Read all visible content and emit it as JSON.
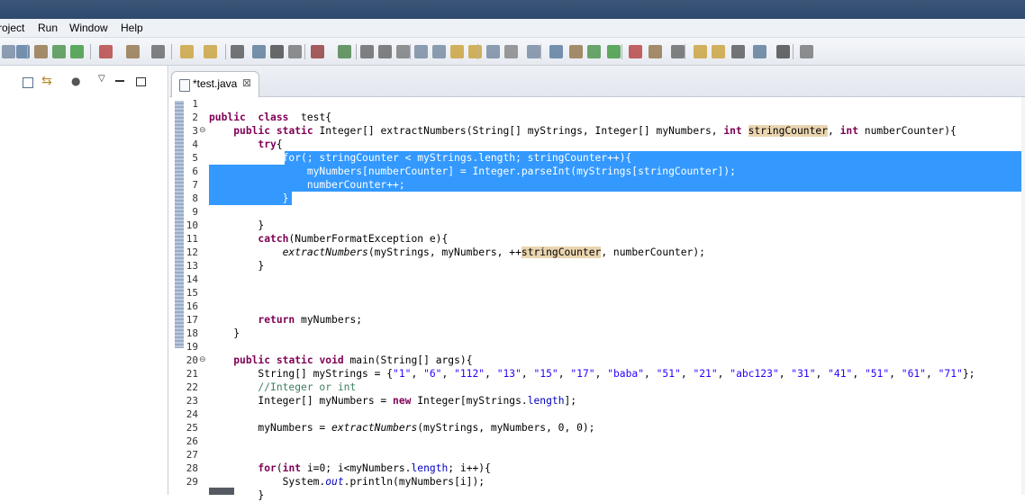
{
  "menu": {
    "items": [
      "roject",
      "Run",
      "Window",
      "Help"
    ]
  },
  "toolbar": {
    "icon_colors": [
      "#6b7f99",
      "#4b6f96",
      "#8a6a3a",
      "#3c8a3c",
      "#2d8f2d",
      "#b03030",
      "#8a6a3a",
      "#5a5a5a",
      "#c79a2a",
      "#c79a2a",
      "#4a4a4a",
      "#4f6f8f",
      "#3a3a3a",
      "#6b6b6b",
      "#8a2a2a",
      "#3a7a3a",
      "#5a5a5a",
      "#5a5a5a",
      "#6f6f6f",
      "#6a7f99",
      "#6a7f99",
      "#c79a2a",
      "#c79a2a",
      "#6a7f99",
      "#7a7a7a"
    ]
  },
  "left_panel": {
    "icons": [
      "collapse-all-icon",
      "link-with-editor-icon",
      "focus-icon",
      "view-menu-icon",
      "minimize-icon",
      "maximize-icon"
    ]
  },
  "editor": {
    "tab": {
      "label": "*test.java",
      "close": "⊠"
    },
    "lines": [
      {
        "n": "1",
        "fold": "",
        "segs": []
      },
      {
        "n": "2",
        "fold": "",
        "segs": [
          [
            "kw",
            "public"
          ],
          [
            "",
            "  "
          ],
          [
            "kw",
            "class"
          ],
          [
            "",
            "  test{"
          ]
        ]
      },
      {
        "n": "3",
        "fold": "⊖",
        "segs": [
          [
            "",
            "    "
          ],
          [
            "kw",
            "public"
          ],
          [
            "",
            " "
          ],
          [
            "kw",
            "static"
          ],
          [
            "",
            " Integer[] extractNumbers(String[] myStrings, Integer[] myNumbers, "
          ],
          [
            "kw",
            "int"
          ],
          [
            "",
            " "
          ],
          [
            "occ",
            "stringCounter"
          ],
          [
            "",
            ", "
          ],
          [
            "kw",
            "int"
          ],
          [
            "",
            " numberCounter){"
          ]
        ]
      },
      {
        "n": "4",
        "fold": "",
        "segs": [
          [
            "",
            "        "
          ],
          [
            "kw",
            "try"
          ],
          [
            "",
            "{"
          ]
        ]
      },
      {
        "n": "5",
        "fold": "",
        "segs": [
          [
            "",
            "            "
          ],
          [
            "sel",
            "for(; stringCounter < myStrings.length; stringCounter++){"
          ]
        ]
      },
      {
        "n": "6",
        "fold": "",
        "segs": [
          [
            "sel",
            "                myNumbers[numberCounter] = Integer.parseInt(myStrings[stringCounter]);"
          ]
        ]
      },
      {
        "n": "7",
        "fold": "",
        "segs": [
          [
            "sel",
            "                numberCounter++;"
          ]
        ]
      },
      {
        "n": "8",
        "fold": "",
        "segs": [
          [
            "sel",
            "            }"
          ]
        ]
      },
      {
        "n": "9",
        "fold": "",
        "segs": []
      },
      {
        "n": "10",
        "fold": "",
        "segs": [
          [
            "",
            "        }"
          ]
        ]
      },
      {
        "n": "11",
        "fold": "",
        "segs": [
          [
            "",
            "        "
          ],
          [
            "kw",
            "catch"
          ],
          [
            "",
            "(NumberFormatException e){"
          ]
        ]
      },
      {
        "n": "12",
        "fold": "",
        "segs": [
          [
            "",
            "            "
          ],
          [
            "it",
            "extractNumbers"
          ],
          [
            "",
            "(myStrings, myNumbers, ++"
          ],
          [
            "occ",
            "stringCounter"
          ],
          [
            "",
            ", numberCounter);"
          ]
        ]
      },
      {
        "n": "13",
        "fold": "",
        "segs": [
          [
            "",
            "        }"
          ]
        ]
      },
      {
        "n": "14",
        "fold": "",
        "segs": []
      },
      {
        "n": "15",
        "fold": "",
        "segs": []
      },
      {
        "n": "16",
        "fold": "",
        "segs": []
      },
      {
        "n": "17",
        "fold": "",
        "segs": [
          [
            "",
            "        "
          ],
          [
            "kw",
            "return"
          ],
          [
            "",
            " myNumbers;"
          ]
        ]
      },
      {
        "n": "18",
        "fold": "",
        "segs": [
          [
            "",
            "    }"
          ]
        ]
      },
      {
        "n": "19",
        "fold": "",
        "segs": []
      },
      {
        "n": "20",
        "fold": "⊖",
        "segs": [
          [
            "",
            "    "
          ],
          [
            "kw",
            "public"
          ],
          [
            "",
            " "
          ],
          [
            "kw",
            "static"
          ],
          [
            "",
            " "
          ],
          [
            "kw",
            "void"
          ],
          [
            "",
            " main(String[] args){"
          ]
        ]
      },
      {
        "n": "21",
        "fold": "",
        "segs": [
          [
            "",
            "        String[] myStrings = {"
          ],
          [
            "str",
            "\"1\""
          ],
          [
            "",
            ", "
          ],
          [
            "str",
            "\"6\""
          ],
          [
            "",
            ", "
          ],
          [
            "str",
            "\"112\""
          ],
          [
            "",
            ", "
          ],
          [
            "str",
            "\"13\""
          ],
          [
            "",
            ", "
          ],
          [
            "str",
            "\"15\""
          ],
          [
            "",
            ", "
          ],
          [
            "str",
            "\"17\""
          ],
          [
            "",
            ", "
          ],
          [
            "str",
            "\"baba\""
          ],
          [
            "",
            ", "
          ],
          [
            "str",
            "\"51\""
          ],
          [
            "",
            ", "
          ],
          [
            "str",
            "\"21\""
          ],
          [
            "",
            ", "
          ],
          [
            "str",
            "\"abc123\""
          ],
          [
            "",
            ", "
          ],
          [
            "str",
            "\"31\""
          ],
          [
            "",
            ", "
          ],
          [
            "str",
            "\"41\""
          ],
          [
            "",
            ", "
          ],
          [
            "str",
            "\"51\""
          ],
          [
            "",
            ", "
          ],
          [
            "str",
            "\"61\""
          ],
          [
            "",
            ", "
          ],
          [
            "str",
            "\"71\""
          ],
          [
            "",
            "};"
          ]
        ]
      },
      {
        "n": "22",
        "fold": "",
        "segs": [
          [
            "",
            "        "
          ],
          [
            "cmt",
            "//Integer or int"
          ]
        ]
      },
      {
        "n": "23",
        "fold": "",
        "segs": [
          [
            "",
            "        Integer[] myNumbers = "
          ],
          [
            "kw",
            "new"
          ],
          [
            "",
            " Integer[myStrings."
          ],
          [
            "fld",
            "length"
          ],
          [
            "",
            "];"
          ]
        ]
      },
      {
        "n": "24",
        "fold": "",
        "segs": []
      },
      {
        "n": "25",
        "fold": "",
        "segs": [
          [
            "",
            "        myNumbers = "
          ],
          [
            "it",
            "extractNumbers"
          ],
          [
            "",
            "(myStrings, myNumbers, 0, 0);"
          ]
        ]
      },
      {
        "n": "26",
        "fold": "",
        "segs": []
      },
      {
        "n": "27",
        "fold": "",
        "segs": []
      },
      {
        "n": "28",
        "fold": "",
        "segs": [
          [
            "",
            "        "
          ],
          [
            "kw",
            "for"
          ],
          [
            "",
            "("
          ],
          [
            "kw",
            "int"
          ],
          [
            "",
            " i=0; i<myNumbers."
          ],
          [
            "fld",
            "length"
          ],
          [
            "",
            "; i++){"
          ]
        ]
      },
      {
        "n": "29",
        "fold": "",
        "segs": [
          [
            "",
            "            System."
          ],
          [
            "fldit",
            "out"
          ],
          [
            "",
            ".println(myNumbers[i]);"
          ]
        ]
      },
      {
        "n": "",
        "fold": "",
        "segs": [
          [
            "",
            "        }"
          ]
        ]
      }
    ]
  }
}
